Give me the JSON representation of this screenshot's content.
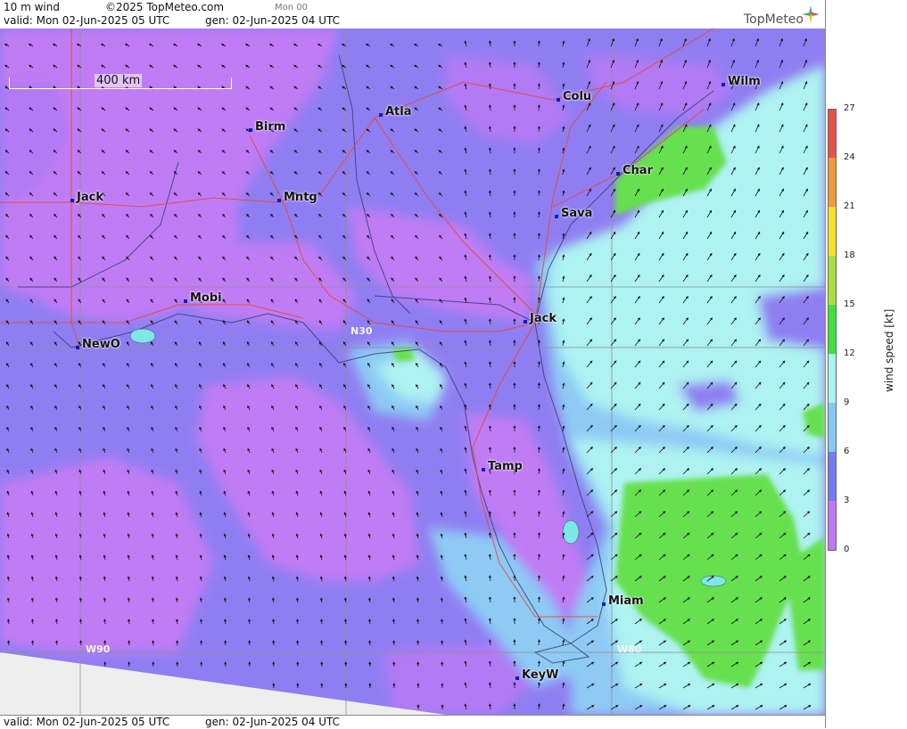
{
  "header": {
    "product": "10 m wind",
    "copyright": "©2025 TopMeteo.com",
    "step": "Mon 00",
    "valid": "valid:  Mon  02-Jun-2025  05 UTC",
    "gen": "gen:  02-Jun-2025 04 UTC"
  },
  "footer": {
    "valid": "valid:  Mon  02-Jun-2025  05 UTC",
    "gen": "gen:  02-Jun-2025 04 UTC"
  },
  "brand": {
    "logo_text": "TopMeteo"
  },
  "map": {
    "scale_label": "400 km",
    "grid_labels": {
      "lat": "N30",
      "lon_west": "W90",
      "lon_east": "W80"
    },
    "cities": [
      {
        "name": "Jack",
        "id": "jack-ms"
      },
      {
        "name": "Birm",
        "id": "birm"
      },
      {
        "name": "Atla",
        "id": "atla"
      },
      {
        "name": "Colu",
        "id": "colu"
      },
      {
        "name": "Wilm",
        "id": "wilm"
      },
      {
        "name": "Char",
        "id": "char"
      },
      {
        "name": "Mntg",
        "id": "mntg"
      },
      {
        "name": "Sava",
        "id": "sava"
      },
      {
        "name": "Mobi",
        "id": "mobi"
      },
      {
        "name": "Jack",
        "id": "jack-fl"
      },
      {
        "name": "NewO",
        "id": "newo"
      },
      {
        "name": "Tamp",
        "id": "tamp"
      },
      {
        "name": "Miam",
        "id": "miam"
      },
      {
        "name": "KeyW",
        "id": "keyw"
      }
    ]
  },
  "colorbar": {
    "title": "wind speed [kt]",
    "ticks": [
      "27",
      "24",
      "21",
      "18",
      "15",
      "12",
      "9",
      "6",
      "3",
      "0"
    ],
    "colors": [
      "#e8504a",
      "#f09a40",
      "#f7e030",
      "#a8e040",
      "#40e040",
      "#a8f4f0",
      "#88c8f4",
      "#7878f0",
      "#c078f4"
    ]
  }
}
